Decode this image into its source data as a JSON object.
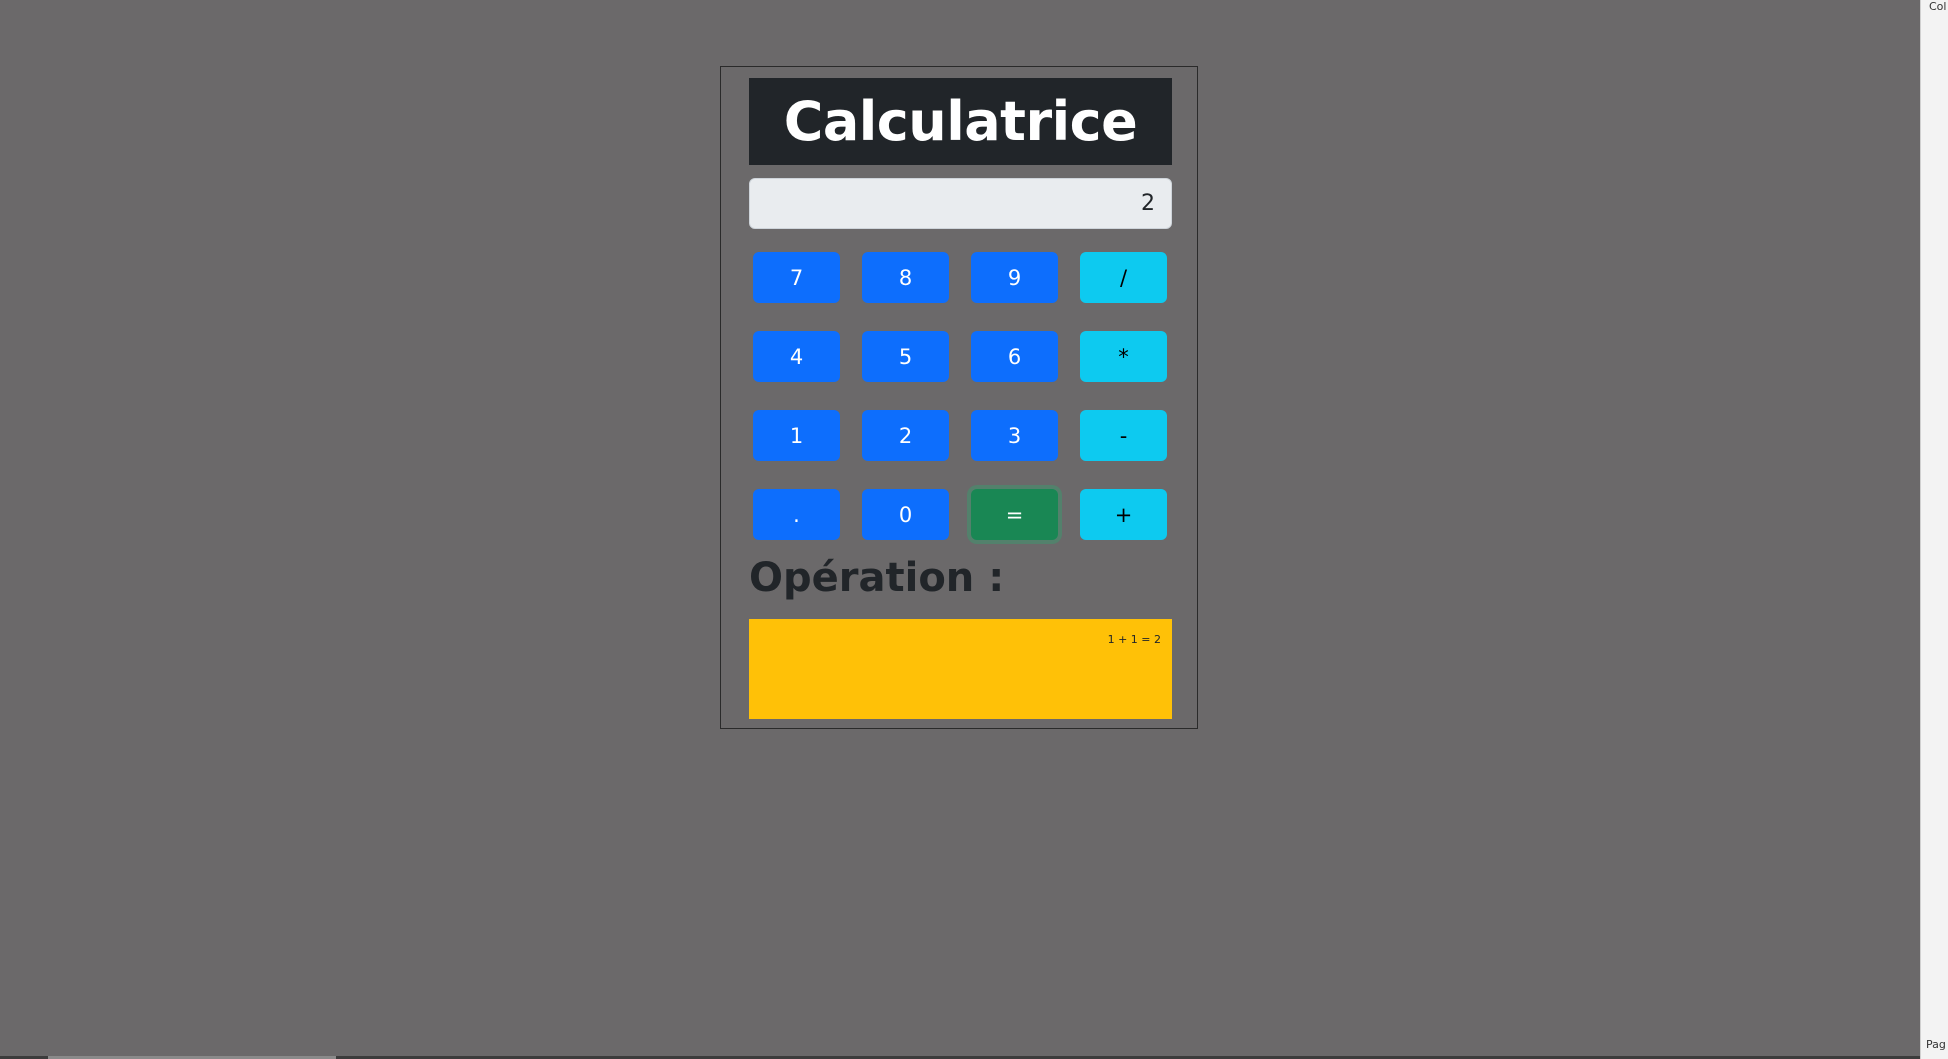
{
  "app": {
    "title": "Calculatrice"
  },
  "display": {
    "value": "2"
  },
  "keys": {
    "k7": "7",
    "k8": "8",
    "k9": "9",
    "div": "/",
    "k4": "4",
    "k5": "5",
    "k6": "6",
    "mul": "*",
    "k1": "1",
    "k2": "2",
    "k3": "3",
    "sub": "-",
    "dot": ".",
    "k0": "0",
    "eq": "=",
    "add": "+"
  },
  "operation": {
    "label": "Opération :",
    "history": "1 + 1 = 2"
  },
  "window": {
    "right_top_text": "Col",
    "right_bottom_text": "Pag"
  },
  "colors": {
    "background": "#6b696a",
    "title_bg": "#212529",
    "number_key": "#0d6efd",
    "operator_key": "#0dcaf0",
    "equals_key": "#198754",
    "result_box": "#ffc107",
    "display_bg": "#e9ecef"
  }
}
